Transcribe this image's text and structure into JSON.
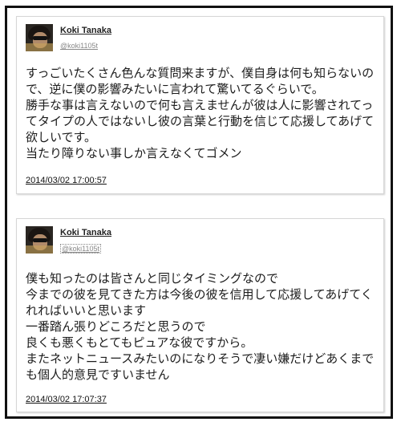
{
  "tweets": [
    {
      "author": "Koki Tanaka",
      "handle": "@koki1105t",
      "text": "すっごいたくさん色んな質問来ますが、僕自身は何も知らないので、逆に僕の影響みたいに言われて驚いてるぐらいで。\n勝手な事は言えないので何も言えませんが彼は人に影響されてってタイプの人ではないし彼の言葉と行動を信じて応援してあげて欲しいです。\n当たり障りない事しか言えなくてゴメン",
      "timestamp": "2014/03/02 17:00:57"
    },
    {
      "author": "Koki Tanaka",
      "handle": "@koki1105t",
      "text": "僕も知ったのは皆さんと同じタイミングなので\n今までの彼を見てきた方は今後の彼を信用して応援してあげてくれればいいと思います\n一番踏ん張りどころだと思うので\n良くも悪くもとてもピュアな彼ですから。\nまたネットニュースみたいのになりそうで凄い嫌だけどあくまでも個人的意見ですいません",
      "timestamp": "2014/03/02 17:07:37"
    }
  ]
}
